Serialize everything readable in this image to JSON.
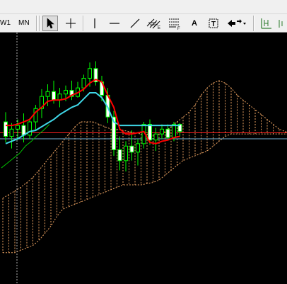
{
  "toolbar": {
    "timeframes": [
      "W1",
      "MN"
    ],
    "text_tool_label": "A",
    "colors": {
      "background": "#f0f0f0",
      "cursor_green": "#2a7a2a"
    }
  },
  "icons": {
    "cursor": "cursor-arrow-icon",
    "crosshair": "crosshair-icon",
    "vertical_line": "vertical-line-icon",
    "horizontal_line": "horizontal-line-icon",
    "trendline": "trendline-icon",
    "equidistant_channel": "equidistant-channel-icon",
    "fibonacci": "fibonacci-retracement-icon",
    "text": "text-label-icon",
    "arrows": "arrows-menu-icon",
    "period_separators": "period-separators-icon"
  },
  "chart_data": {
    "type": "candlestick",
    "colors": {
      "background": "#000000",
      "bull_candle": "#00ff00",
      "bear_candle": "#ffffff",
      "tenkan_sen": "#ff0000",
      "kijun_sen": "#3fd6e6",
      "chikou_span": "#00c000",
      "cloud": "#e8a060",
      "price_line": "#ff2020",
      "ask_line": "#7ab6d8",
      "current_time_line": "#b0b0b0"
    },
    "candles": [
      {
        "o": 128,
        "h": 136,
        "l": 111,
        "c": 116
      },
      {
        "o": 116,
        "h": 127,
        "l": 106,
        "c": 122
      },
      {
        "o": 122,
        "h": 130,
        "l": 113,
        "c": 125
      },
      {
        "o": 125,
        "h": 135,
        "l": 111,
        "c": 117
      },
      {
        "o": 117,
        "h": 131,
        "l": 114,
        "c": 128
      },
      {
        "o": 128,
        "h": 142,
        "l": 121,
        "c": 139
      },
      {
        "o": 139,
        "h": 155,
        "l": 131,
        "c": 149
      },
      {
        "o": 149,
        "h": 159,
        "l": 141,
        "c": 153
      },
      {
        "o": 153,
        "h": 162,
        "l": 143,
        "c": 146
      },
      {
        "o": 146,
        "h": 156,
        "l": 140,
        "c": 151
      },
      {
        "o": 151,
        "h": 158,
        "l": 145,
        "c": 154
      },
      {
        "o": 154,
        "h": 162,
        "l": 146,
        "c": 149
      },
      {
        "o": 149,
        "h": 161,
        "l": 148,
        "c": 156
      },
      {
        "o": 156,
        "h": 167,
        "l": 153,
        "c": 164
      },
      {
        "o": 164,
        "h": 177,
        "l": 157,
        "c": 172
      },
      {
        "o": 172,
        "h": 178,
        "l": 158,
        "c": 161
      },
      {
        "o": 161,
        "h": 166,
        "l": 145,
        "c": 150
      },
      {
        "o": 150,
        "h": 156,
        "l": 127,
        "c": 132
      },
      {
        "o": 132,
        "h": 137,
        "l": 100,
        "c": 105
      },
      {
        "o": 105,
        "h": 116,
        "l": 88,
        "c": 96
      },
      {
        "o": 96,
        "h": 112,
        "l": 87,
        "c": 108
      },
      {
        "o": 108,
        "h": 121,
        "l": 96,
        "c": 103
      },
      {
        "o": 103,
        "h": 114,
        "l": 92,
        "c": 110
      },
      {
        "o": 110,
        "h": 128,
        "l": 106,
        "c": 126
      },
      {
        "o": 126,
        "h": 130,
        "l": 109,
        "c": 113
      },
      {
        "o": 113,
        "h": 123,
        "l": 104,
        "c": 118
      },
      {
        "o": 118,
        "h": 126,
        "l": 114,
        "c": 122
      },
      {
        "o": 122,
        "h": 126,
        "l": 113,
        "c": 115
      },
      {
        "o": 115,
        "h": 128,
        "l": 112,
        "c": 126
      },
      {
        "o": 126,
        "h": 127,
        "l": 116,
        "c": 120
      }
    ],
    "tenkan_sen": [
      125,
      125,
      126,
      128,
      130,
      136,
      140,
      145,
      146,
      146,
      147,
      150,
      152,
      155,
      160,
      163,
      161,
      150,
      140,
      122,
      118,
      118,
      119,
      120,
      111,
      110,
      112,
      113,
      115,
      116
    ],
    "kijun_sen": [
      110,
      112,
      114,
      117,
      120,
      121,
      124,
      127,
      130,
      134,
      137,
      140,
      142,
      147,
      152,
      152,
      148,
      140,
      128,
      125,
      125,
      125,
      125,
      125,
      125,
      125,
      125,
      125,
      125,
      125
    ],
    "chikou_span": [
      90,
      94,
      98,
      102,
      108,
      112,
      117,
      121,
      126
    ],
    "cloud_a": [
      65,
      68,
      71,
      74,
      78,
      82,
      88,
      94,
      100,
      106,
      112,
      118,
      124,
      128,
      128,
      128,
      126,
      124,
      122,
      122,
      121,
      120,
      119,
      118,
      118,
      117,
      118,
      120,
      124,
      128,
      132,
      136,
      142,
      150,
      156,
      160,
      162,
      160,
      156,
      150,
      146,
      142,
      138,
      134,
      130,
      126,
      122,
      120,
      118,
      116
    ],
    "cloud_b": [
      20,
      20,
      20,
      22,
      24,
      26,
      30,
      36,
      42,
      50,
      56,
      58,
      60,
      62,
      64,
      66,
      68,
      70,
      72,
      74,
      76,
      76,
      76,
      76,
      77,
      78,
      80,
      84,
      88,
      92,
      96,
      98,
      100,
      102,
      104,
      108,
      112,
      116,
      118,
      118,
      118,
      118,
      118,
      118,
      118,
      118,
      118,
      118,
      118,
      118
    ],
    "bid_price": 119,
    "ask_price": 114,
    "ylim": [
      0,
      190
    ],
    "n_slots": 50
  }
}
